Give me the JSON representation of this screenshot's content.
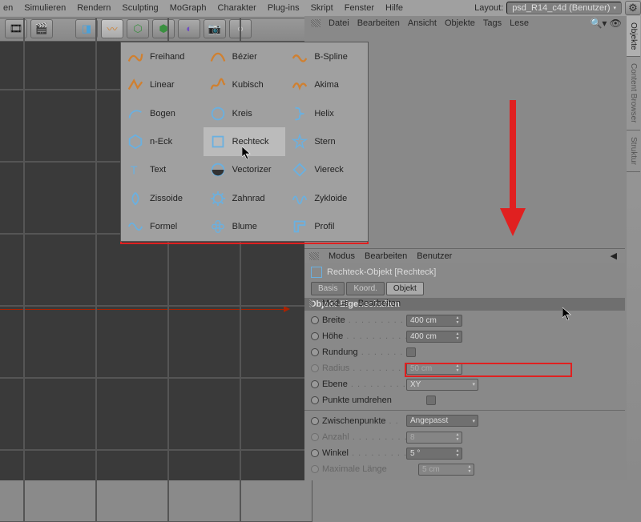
{
  "top_menu": [
    "en",
    "Simulieren",
    "Rendern",
    "Sculpting",
    "MoGraph",
    "Charakter",
    "Plug-ins",
    "Skript",
    "Fenster",
    "Hilfe"
  ],
  "layout": {
    "label": "Layout:",
    "value": "psd_R14_c4d (Benutzer)"
  },
  "panel_menu": [
    "Datei",
    "Bearbeiten",
    "Ansicht",
    "Objekte",
    "Tags",
    "Lese"
  ],
  "side_tabs": {
    "active": "Objekte",
    "others": [
      "Content Browser",
      "Struktur"
    ]
  },
  "mid_panel_menu": [
    "Modus",
    "Bearbeiten"
  ],
  "attr_menu": [
    "Modus",
    "Bearbeiten",
    "Benutzer"
  ],
  "object": {
    "title": "Rechteck-Objekt [Rechteck]",
    "tabs": [
      "Basis",
      "Koord.",
      "Objekt"
    ],
    "active_tab": "Objekt",
    "section": "Objekt-Eigenschaften",
    "props": {
      "breite": {
        "label": "Breite",
        "value": "400 cm"
      },
      "hoehe": {
        "label": "Höhe",
        "value": "400 cm"
      },
      "rundung": {
        "label": "Rundung"
      },
      "radius": {
        "label": "Radius",
        "value": "50 cm"
      },
      "ebene": {
        "label": "Ebene",
        "value": "XY"
      },
      "punkte": {
        "label": "Punkte umdrehen"
      },
      "zwischen": {
        "label": "Zwischenpunkte",
        "value": "Angepasst"
      },
      "anzahl": {
        "label": "Anzahl",
        "value": "8"
      },
      "winkel": {
        "label": "Winkel",
        "value": "5 °"
      },
      "maxlen": {
        "label": "Maximale Länge",
        "value": "5 cm"
      }
    }
  },
  "splines": {
    "row1": [
      "Freihand",
      "Bézier",
      "B-Spline"
    ],
    "row2": [
      "Linear",
      "Kubisch",
      "Akima"
    ],
    "grid": [
      [
        "Bogen",
        "Kreis",
        "Helix"
      ],
      [
        "n-Eck",
        "Rechteck",
        "Stern"
      ],
      [
        "Text",
        "Vectorizer",
        "Viereck"
      ],
      [
        "Zissoide",
        "Zahnrad",
        "Zykloide"
      ],
      [
        "Formel",
        "Blume",
        "Profil"
      ]
    ]
  }
}
